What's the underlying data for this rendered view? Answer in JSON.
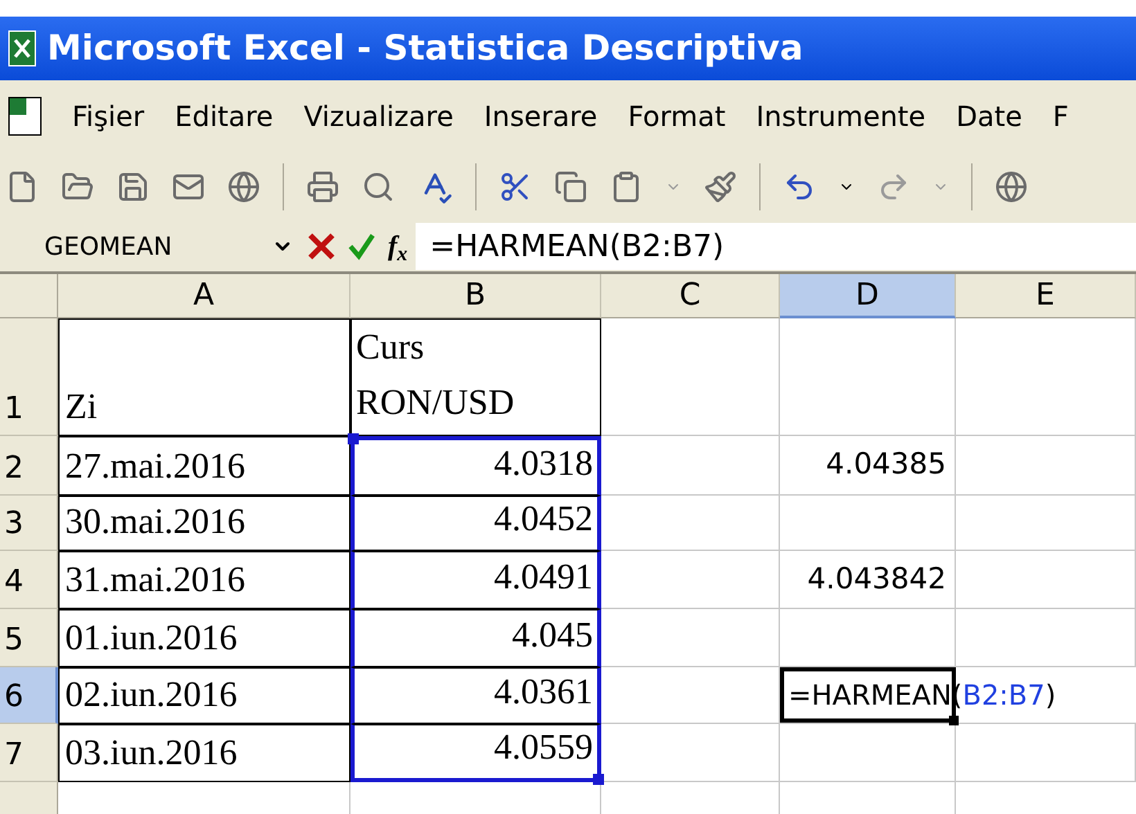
{
  "window": {
    "title": "Microsoft Excel - Statistica Descriptiva"
  },
  "menu": [
    {
      "label": "Fişier"
    },
    {
      "label": "Editare"
    },
    {
      "label": "Vizualizare"
    },
    {
      "label": "Inserare"
    },
    {
      "label": "Format"
    },
    {
      "label": "Instrumente"
    },
    {
      "label": "Date"
    },
    {
      "label": "F"
    }
  ],
  "formula_bar": {
    "name_box": "GEOMEAN",
    "function_button": "f$_{x}$",
    "formula": "=HARMEAN(B2:B7)"
  },
  "columns": [
    {
      "label": "A",
      "selected": false
    },
    {
      "label": "B",
      "selected": false
    },
    {
      "label": "C",
      "selected": false
    },
    {
      "label": "D",
      "selected": true
    },
    {
      "label": "E",
      "selected": false
    }
  ],
  "rows": [
    {
      "label": "1",
      "selected": false,
      "a": "Zi",
      "b": "Curs\nRON/USD",
      "in_range": false
    },
    {
      "label": "2",
      "selected": false,
      "a": "27.mai.2016",
      "b": "4.0318",
      "d": "4.04385",
      "in_range": true
    },
    {
      "label": "3",
      "selected": false,
      "a": "30.mai.2016",
      "b": "4.0452",
      "in_range": true
    },
    {
      "label": "4",
      "selected": false,
      "a": "31.mai.2016",
      "b": "4.0491",
      "d": "4.043842",
      "in_range": true
    },
    {
      "label": "5",
      "selected": false,
      "a": "01.iun.2016",
      "b": "4.045",
      "in_range": true
    },
    {
      "label": "6",
      "selected": true,
      "a": "02.iun.2016",
      "b": "4.0361",
      "in_range": true,
      "d_editing": [
        {
          "text": "=HARMEAN(",
          "kind": "plain"
        },
        {
          "text": "B2:B7",
          "kind": "reference"
        },
        {
          "text": ")",
          "kind": "plain"
        }
      ]
    },
    {
      "label": "7",
      "selected": false,
      "a": "03.iun.2016",
      "b": "4.0559",
      "in_range": true
    }
  ]
}
